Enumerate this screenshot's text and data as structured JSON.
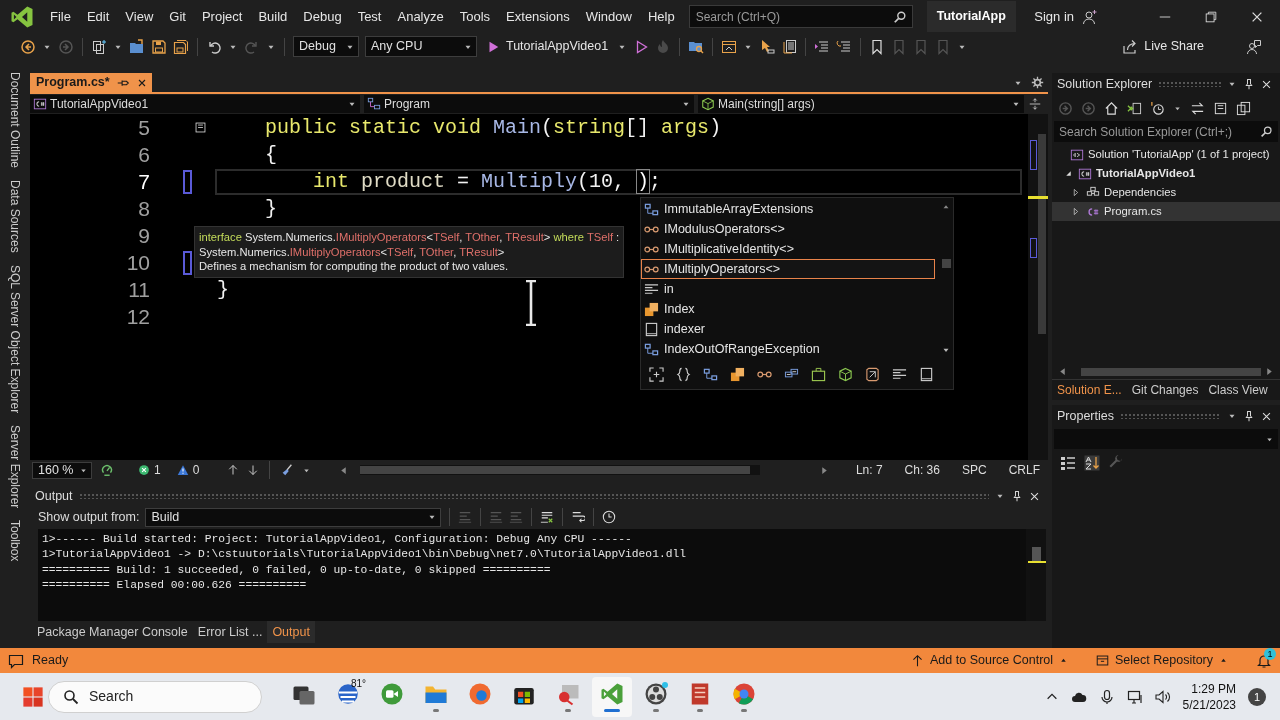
{
  "menu": [
    "File",
    "Edit",
    "View",
    "Git",
    "Project",
    "Build",
    "Debug",
    "Test",
    "Analyze",
    "Tools",
    "Extensions",
    "Window",
    "Help"
  ],
  "search": {
    "placeholder": "Search (Ctrl+Q)"
  },
  "solution_name": "TutorialApp",
  "sign_in": "Sign in",
  "toolbar": {
    "configuration": "Debug",
    "platform": "Any CPU",
    "startup_project": "TutorialAppVideo1",
    "live_share": "Live Share"
  },
  "tool_tabs": [
    "Document Outline",
    "Data Sources",
    "SQL Server Object Explorer",
    "Server Explorer",
    "Toolbox"
  ],
  "document_tabs": [
    {
      "label": "Program.cs*",
      "selected": true
    }
  ],
  "navigation_bar": [
    "TutorialAppVideo1",
    "Program",
    "Main(string[] args)"
  ],
  "editor": {
    "lines": [
      {
        "number": "5",
        "current": false,
        "changed": false,
        "collapsible": true,
        "tokens": [
          {
            "text": "    public static void ",
            "kind": "keyword"
          },
          {
            "text": "Main",
            "kind": "method"
          },
          {
            "text": "(",
            "kind": "punct"
          },
          {
            "text": "string",
            "kind": "keyword"
          },
          {
            "text": "[] ",
            "kind": "punct"
          },
          {
            "text": "args",
            "kind": "keyword"
          },
          {
            "text": ")",
            "kind": "punct"
          }
        ]
      },
      {
        "number": "6",
        "current": false,
        "changed": false,
        "collapsible": false,
        "tokens": [
          {
            "text": "    {",
            "kind": "punct"
          }
        ]
      },
      {
        "number": "7",
        "current": true,
        "changed": true,
        "collapsible": false,
        "tokens": [
          {
            "text": "        int ",
            "kind": "keyword"
          },
          {
            "text": "product",
            "kind": "ident"
          },
          {
            "text": " = ",
            "kind": "punct"
          },
          {
            "text": "Multiply",
            "kind": "method"
          },
          {
            "text": "(10, ",
            "kind": "punct"
          },
          {
            "text": ")",
            "kind": "match"
          },
          {
            "text": ";",
            "kind": "punct"
          }
        ]
      },
      {
        "number": "8",
        "current": false,
        "changed": false,
        "collapsible": false,
        "tokens": [
          {
            "text": "    }",
            "kind": "punct"
          }
        ]
      },
      {
        "number": "9",
        "current": false,
        "changed": false,
        "collapsible": false
      },
      {
        "number": "10",
        "current": false,
        "changed": true,
        "collapsible": false
      },
      {
        "number": "11",
        "current": false,
        "changed": false,
        "collapsible": false,
        "tokens": [
          {
            "text": "}",
            "kind": "punct"
          }
        ]
      },
      {
        "number": "12",
        "current": false,
        "changed": false,
        "collapsible": false
      }
    ],
    "quick_info": [
      {
        "tokens": [
          {
            "text": "interface",
            "kind": "keyword"
          },
          {
            "text": " System.Numerics.",
            "kind": "plain"
          },
          {
            "text": "IMultiplyOperators",
            "kind": "type"
          },
          {
            "text": "<",
            "kind": "plain"
          },
          {
            "text": "TSelf",
            "kind": "type"
          },
          {
            "text": ", ",
            "kind": "plain"
          },
          {
            "text": "TOther",
            "kind": "type"
          },
          {
            "text": ", ",
            "kind": "plain"
          },
          {
            "text": "TResult",
            "kind": "type"
          },
          {
            "text": "> ",
            "kind": "plain"
          },
          {
            "text": "where ",
            "kind": "keyword"
          },
          {
            "text": "TSelf",
            "kind": "type"
          },
          {
            "text": " :",
            "kind": "plain"
          }
        ]
      },
      {
        "tokens": [
          {
            "text": "System.Numerics.",
            "kind": "plain"
          },
          {
            "text": "IMultiplyOperators",
            "kind": "type"
          },
          {
            "text": "<",
            "kind": "plain"
          },
          {
            "text": "TSelf",
            "kind": "type"
          },
          {
            "text": ", ",
            "kind": "plain"
          },
          {
            "text": "TOther",
            "kind": "type"
          },
          {
            "text": ", ",
            "kind": "plain"
          },
          {
            "text": "TResult",
            "kind": "type"
          },
          {
            "text": ">",
            "kind": "plain"
          }
        ]
      },
      {
        "tokens": [
          {
            "text": "Defines a mechanism for computing the product of two values.",
            "kind": "plain"
          }
        ]
      }
    ],
    "completion": [
      {
        "label": "ImmutableArrayExtensions",
        "kind": "class",
        "selected": false
      },
      {
        "label": "IModulusOperators<>",
        "kind": "interface",
        "selected": false
      },
      {
        "label": "IMultiplicativeIdentity<>",
        "kind": "interface",
        "selected": false
      },
      {
        "label": "IMultiplyOperators<>",
        "kind": "interface",
        "selected": true
      },
      {
        "label": "in",
        "kind": "keyword",
        "selected": false
      },
      {
        "label": "Index",
        "kind": "struct",
        "selected": false
      },
      {
        "label": "indexer",
        "kind": "snippet",
        "selected": false
      },
      {
        "label": "IndexOutOfRangeException",
        "kind": "class",
        "selected": false
      }
    ],
    "status": {
      "zoom": "160 %",
      "errors": "1",
      "warnings": "0",
      "line": "Ln: 7",
      "column": "Ch: 36",
      "whitespace": "SPC",
      "line_ending": "CRLF"
    }
  },
  "solution_explorer": {
    "title": "Solution Explorer",
    "search": {
      "placeholder": "Search Solution Explorer (Ctrl+;)"
    },
    "tree": [
      {
        "label": "Solution 'TutorialApp' (1 of 1 project)",
        "kind": "solution",
        "startup": false,
        "selected": false,
        "children": [
          {
            "label": "TutorialAppVideo1",
            "kind": "project",
            "startup": true,
            "selected": false,
            "expanded": true,
            "children": [
              {
                "label": "Dependencies",
                "kind": "dependencies",
                "startup": false,
                "selected": false,
                "expanded": false
              },
              {
                "label": "Program.cs",
                "kind": "code-file",
                "startup": false,
                "selected": true,
                "expanded": false
              }
            ]
          }
        ]
      }
    ],
    "tabs": [
      {
        "label": "Solution E...",
        "selected": true
      },
      {
        "label": "Git Changes",
        "selected": false
      },
      {
        "label": "Class View",
        "selected": false
      }
    ]
  },
  "properties": {
    "title": "Properties"
  },
  "output": {
    "title": "Output",
    "source_label": "Show output from:",
    "source": "Build",
    "lines": [
      "1>------ Build started: Project: TutorialAppVideo1, Configuration: Debug Any CPU ------",
      "1>TutorialAppVideo1 -> D:\\cstuutorials\\TutorialAppVideo1\\bin\\Debug\\net7.0\\TutorialAppVideo1.dll",
      "========== Build: 1 succeeded, 0 failed, 0 up-to-date, 0 skipped ==========",
      "========== Elapsed 00:00.626 =========="
    ],
    "tabs": [
      {
        "label": "Package Manager Console",
        "selected": false
      },
      {
        "label": "Error List ...",
        "selected": false
      },
      {
        "label": "Output",
        "selected": true
      }
    ]
  },
  "status_bar": {
    "message": "Ready",
    "source_control": "Add to Source Control",
    "repository": "Select Repository",
    "notifications": "1"
  },
  "taskbar": {
    "search": "Search",
    "weather": "81°",
    "apps": [
      {
        "kind": "task-view",
        "running": false,
        "active": false
      },
      {
        "kind": "weather",
        "running": false,
        "active": false
      },
      {
        "kind": "chat",
        "running": false,
        "active": false
      },
      {
        "kind": "folder",
        "running": true,
        "active": false
      },
      {
        "kind": "browser",
        "running": false,
        "active": false
      },
      {
        "kind": "store",
        "running": false,
        "active": false
      },
      {
        "kind": "snip",
        "running": true,
        "active": false
      },
      {
        "kind": "ide",
        "running": true,
        "active": true
      },
      {
        "kind": "recorder",
        "running": true,
        "active": false
      },
      {
        "kind": "notes",
        "running": true,
        "active": false
      },
      {
        "kind": "chrome",
        "running": true,
        "active": false
      }
    ],
    "time": "1:29 PM",
    "date": "5/21/2023",
    "notifications": "1"
  }
}
